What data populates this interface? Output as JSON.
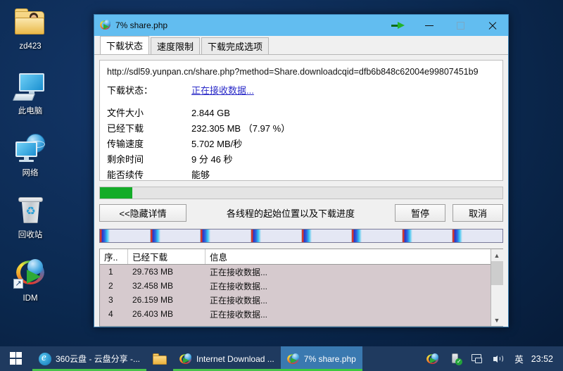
{
  "desktop": {
    "icons": [
      {
        "name": "user-folder",
        "label": "zd423"
      },
      {
        "name": "this-pc",
        "label": "此电脑"
      },
      {
        "name": "network",
        "label": "网络"
      },
      {
        "name": "recycle-bin",
        "label": "回收站"
      },
      {
        "name": "idm-shortcut",
        "label": "IDM"
      }
    ]
  },
  "window": {
    "title": "7% share.php",
    "icon": "idm-icon",
    "controls": {
      "green_arrow": "download-arrow-icon",
      "minimize": "minimize-icon",
      "maximize": "maximize-icon",
      "close": "close-icon"
    },
    "tabs": [
      {
        "label": "下载状态",
        "active": true
      },
      {
        "label": "速度限制",
        "active": false
      },
      {
        "label": "下载完成选项",
        "active": false
      }
    ],
    "url": "http://sdl59.yunpan.cn/share.php?method=Share.downloadcqid=dfb6b848c62004e99807451b9",
    "status": {
      "key": "下载状态：",
      "value": "正在接收数据..."
    },
    "details": [
      {
        "key": "文件大小",
        "value": "2.844  GB"
      },
      {
        "key": "已经下载",
        "value": "232.305  MB （7.97 %）"
      },
      {
        "key": "传输速度",
        "value": "5.702  MB/秒"
      },
      {
        "key": "剩余时间",
        "value": "9 分 46 秒"
      },
      {
        "key": "能否续传",
        "value": "能够"
      }
    ],
    "progress": {
      "percent": 7.97,
      "fill_color": "#14ac28",
      "track_color": "#e4e4e4"
    },
    "buttons": {
      "hide_details": "<<隐藏详情",
      "pause": "暂停",
      "cancel": "取消"
    },
    "hint": "各线程的起始位置以及下载进度",
    "thread_bar": {
      "segments": 8,
      "marker_start_color": "#d33b2c",
      "marker_mid_color": "#2a32c8",
      "marker_end_color": "#37c4f0",
      "track_color": "#e4e7f4"
    },
    "table": {
      "columns": [
        "序..",
        "已经下载",
        "信息"
      ],
      "rows": [
        {
          "index": "1",
          "downloaded": "29.763 MB",
          "info": "正在接收数据..."
        },
        {
          "index": "2",
          "downloaded": "32.458 MB",
          "info": "正在接收数据..."
        },
        {
          "index": "3",
          "downloaded": "26.159 MB",
          "info": "正在接收数据..."
        },
        {
          "index": "4",
          "downloaded": "26.403 MB",
          "info": "正在接收数据..."
        }
      ],
      "scrollbar": {
        "up": "▲",
        "down": "▼"
      }
    }
  },
  "taskbar": {
    "start": "start-button",
    "items": [
      {
        "name": "taskbar-item-edge",
        "label": "360云盘 - 云盘分享 -...",
        "icon": "edge-icon",
        "state": "running"
      },
      {
        "name": "taskbar-item-explorer",
        "label": "",
        "icon": "folder-icon",
        "state": "pinned"
      },
      {
        "name": "taskbar-item-idm",
        "label": "Internet Download ...",
        "icon": "idm-icon",
        "state": "running"
      },
      {
        "name": "taskbar-item-share",
        "label": "7% share.php",
        "icon": "idm-icon",
        "state": "active"
      }
    ],
    "tray": {
      "icons": [
        "idm-tray-icon",
        "usb-eject-icon",
        "network-icon",
        "volume-icon"
      ],
      "ime": "英",
      "clock": "23:52"
    }
  }
}
